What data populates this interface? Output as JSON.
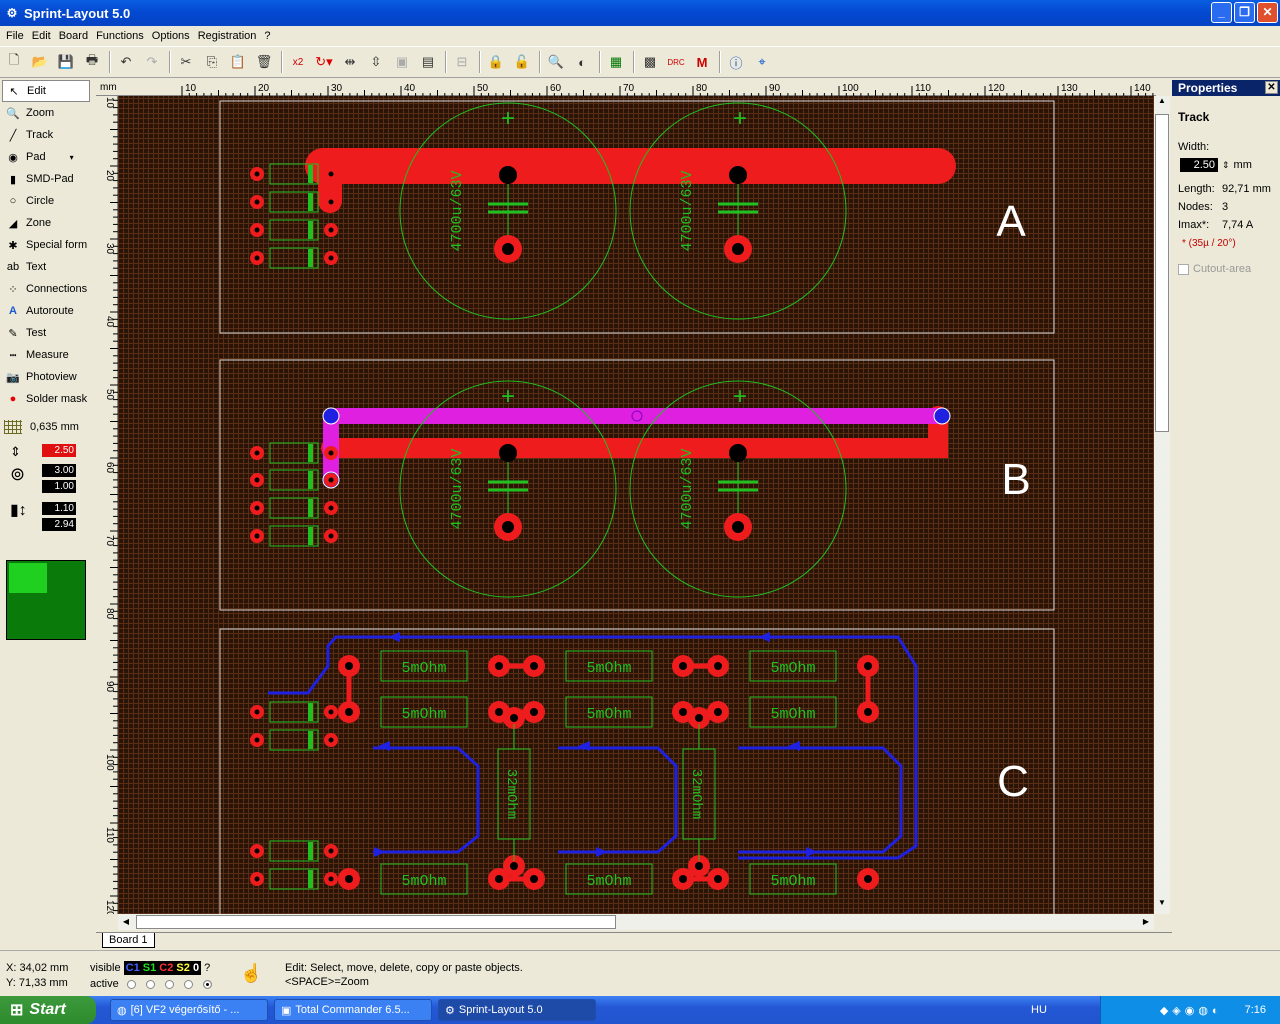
{
  "window": {
    "title": "Sprint-Layout 5.0"
  },
  "menu": [
    "File",
    "Edit",
    "Board",
    "Functions",
    "Options",
    "Registration",
    "?"
  ],
  "toolbar": {
    "icons": [
      "new",
      "open",
      "save",
      "print",
      "undo",
      "redo",
      "cut",
      "copy",
      "paste",
      "delete",
      "x2",
      "rotate",
      "mirror-h",
      "mirror-v",
      "group",
      "ungroup",
      "align",
      "lock",
      "unlock",
      "zoom",
      "transparent",
      "component",
      "drc",
      "macro",
      "info",
      "snap"
    ],
    "x2_label": "x2"
  },
  "tools": [
    {
      "label": "Edit",
      "icon": "arrow-icon"
    },
    {
      "label": "Zoom",
      "icon": "zoom-icon"
    },
    {
      "label": "Track",
      "icon": "track-icon"
    },
    {
      "label": "Pad",
      "icon": "pad-icon"
    },
    {
      "label": "SMD-Pad",
      "icon": "smd-pad-icon"
    },
    {
      "label": "Circle",
      "icon": "circle-icon"
    },
    {
      "label": "Zone",
      "icon": "zone-icon"
    },
    {
      "label": "Special form",
      "icon": "special-form-icon"
    },
    {
      "label": "Text",
      "icon": "text-icon"
    },
    {
      "label": "Connections",
      "icon": "connections-icon"
    },
    {
      "label": "Autoroute",
      "icon": "autoroute-icon"
    },
    {
      "label": "Test",
      "icon": "test-icon"
    },
    {
      "label": "Measure",
      "icon": "measure-icon"
    },
    {
      "label": "Photoview",
      "icon": "photoview-icon"
    },
    {
      "label": "Solder mask",
      "icon": "solder-mask-icon"
    }
  ],
  "grid": {
    "value": "0,635 mm"
  },
  "sizes": {
    "track_width": "2.50",
    "pad_outer": "3.00",
    "pad_inner": "1.00",
    "smd_w": "1.10",
    "smd_h": "2.94"
  },
  "ruler": {
    "unit": "mm",
    "top": [
      "10",
      "20",
      "30",
      "40",
      "50",
      "60",
      "70",
      "80",
      "90",
      "100",
      "110",
      "120",
      "130",
      "140"
    ],
    "left": [
      "10",
      "20",
      "30",
      "40",
      "50",
      "60",
      "70",
      "80",
      "90",
      "100",
      "110",
      "120"
    ]
  },
  "pcb": {
    "sections": [
      "A",
      "B",
      "C"
    ],
    "cap_labels": [
      "4700u/63V",
      "4700u/63V",
      "4700u/63V",
      "4700u/63V"
    ],
    "resistor_labels": [
      "5mOhm",
      "5mOhm",
      "5mOhm",
      "5mOhm",
      "5mOhm",
      "5mOhm",
      "5mOhm",
      "5mOhm",
      "5mOhm"
    ],
    "shunt_labels": [
      "32mOhm",
      "32mOhm"
    ],
    "colors": {
      "copper": "#ee1c1c",
      "selected": "#e020e0",
      "top_track": "#2020e0",
      "silk": "#20c020",
      "outline": "#d8d8d8"
    }
  },
  "tabs": [
    "Board 1"
  ],
  "properties": {
    "title": "Properties",
    "section": "Track",
    "width_label": "Width:",
    "width_value": "2.50",
    "width_unit": "mm",
    "length_label": "Length:",
    "length_value": "92,71 mm",
    "nodes_label": "Nodes:",
    "nodes_value": "3",
    "imax_label": "Imax*:",
    "imax_value": "7,74 A",
    "note": "* (35µ / 20°)",
    "cutout_label": "Cutout-area"
  },
  "status": {
    "x": "X:  34,02 mm",
    "y": "Y:  71,33 mm",
    "visible": "visible",
    "active": "active",
    "layers": [
      "C1",
      "S1",
      "C2",
      "S2",
      "0"
    ],
    "help": "?",
    "hint1": "Edit: Select, move, delete, copy or paste objects.",
    "hint2": "<SPACE>=Zoom"
  },
  "taskbar": {
    "start": "Start",
    "tasks": [
      "[6] VF2 végerősítő - ...",
      "Total Commander 6.5...",
      "Sprint-Layout 5.0"
    ],
    "lang": "HU",
    "time": "7:16"
  }
}
